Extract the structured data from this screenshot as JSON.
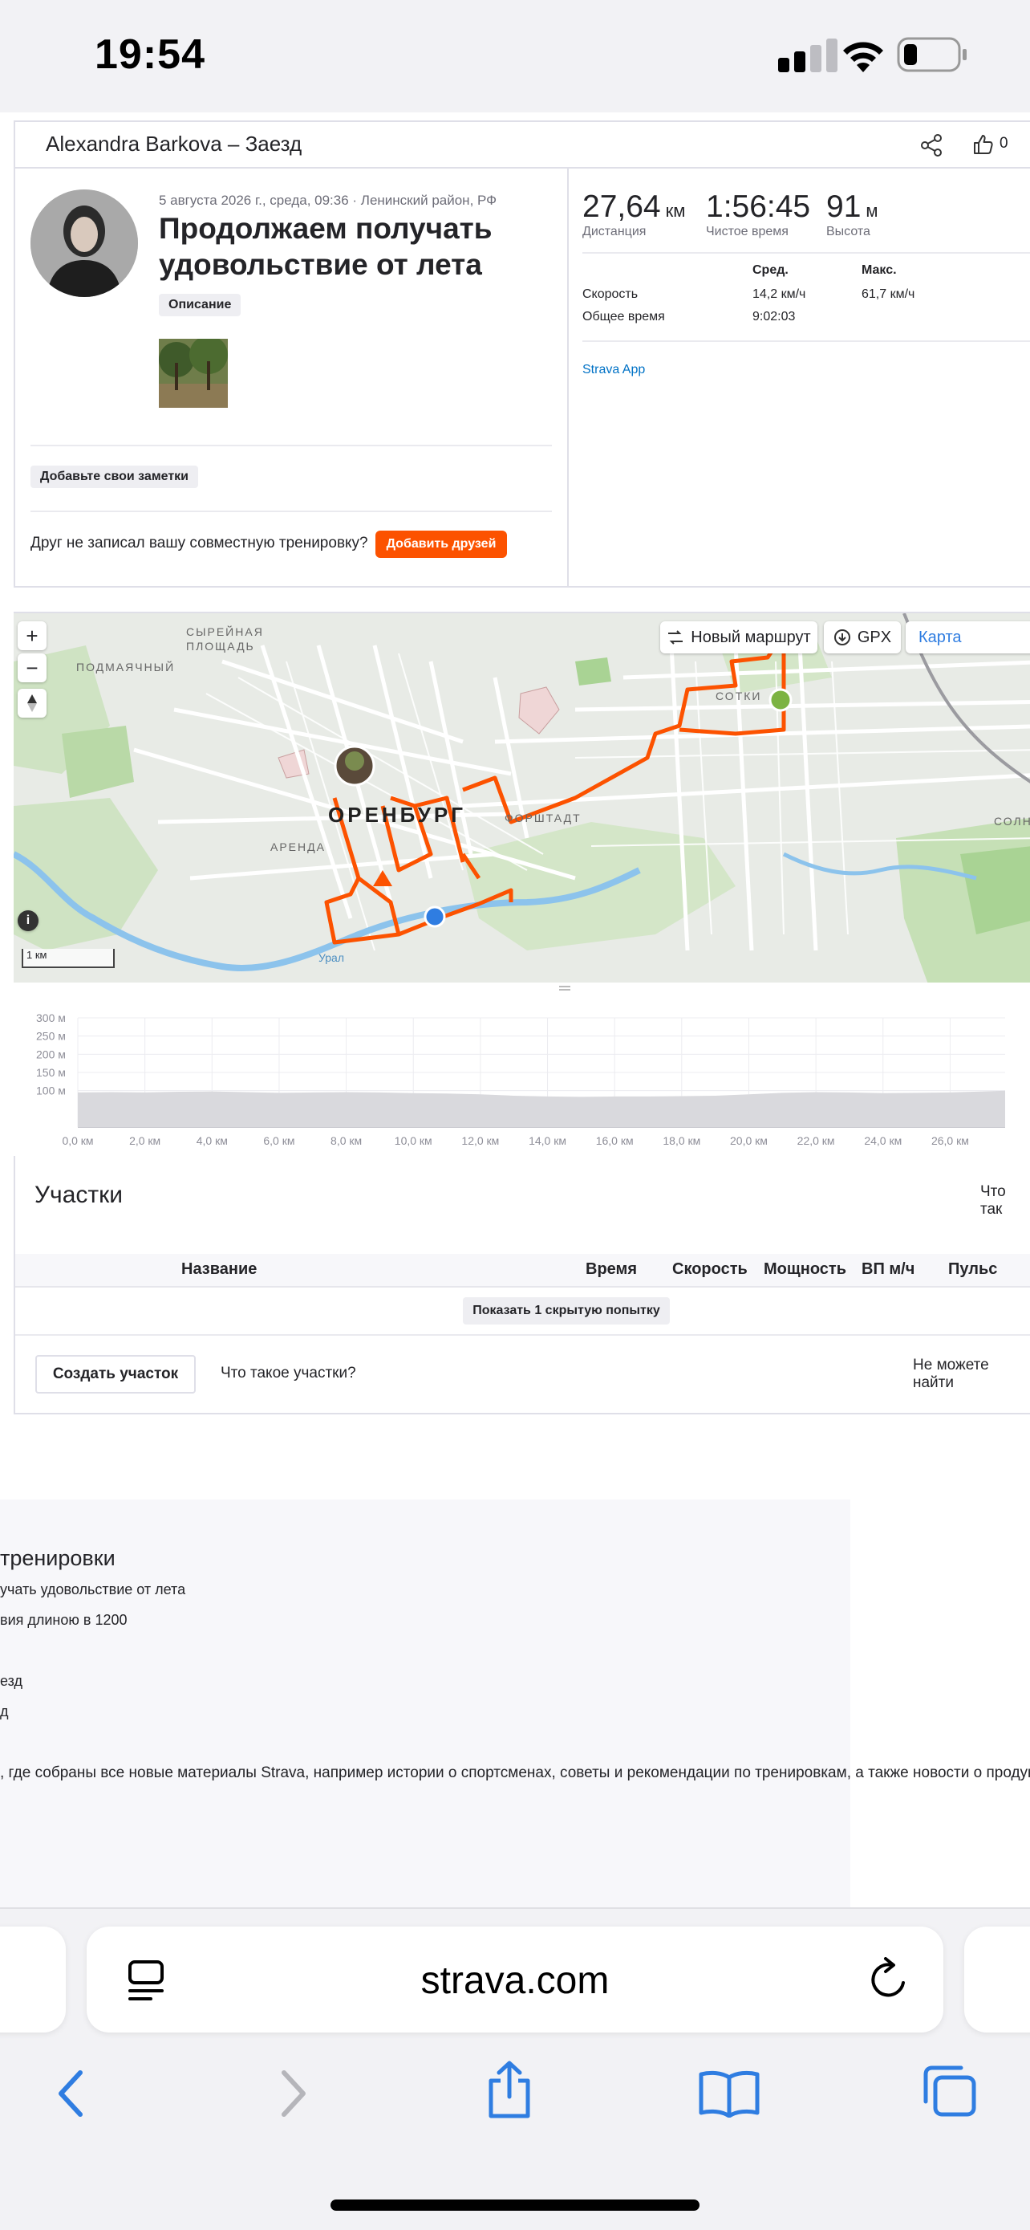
{
  "status": {
    "time": "19:54"
  },
  "activity": {
    "header_title": "Alexandra Barkova – Заезд",
    "kudos_count": "0",
    "meta": "5 августа 2026 г., среда, 09:36 · Ленинский район, РФ",
    "title": "Продолжаем получать удовольствие от лета",
    "description_chip": "Описание",
    "notes_chip": "Добавьте свои заметки",
    "friend_prompt": "Друг не записал вашу совместную тренировку?",
    "add_friends": "Добавить друзей",
    "stats": [
      {
        "value": "27,64",
        "unit": "км",
        "label": "Дистанция"
      },
      {
        "value": "1:56:45",
        "unit": "",
        "label": "Чистое время"
      },
      {
        "value": "91",
        "unit": "м",
        "label": "Высота"
      }
    ],
    "table": {
      "col_avg": "Сред.",
      "col_max": "Макс.",
      "rows": [
        {
          "label": "Скорость",
          "avg": "14,2 км/ч",
          "max": "61,7 км/ч"
        },
        {
          "label": "Общее время",
          "avg": "9:02:03",
          "max": ""
        }
      ]
    },
    "device": "Strava App"
  },
  "map": {
    "new_route": "Новый маршрут",
    "gpx": "GPX",
    "map_type": "Карта",
    "scale": "1 км",
    "zoom_in": "+",
    "zoom_out": "−",
    "labels": {
      "city": "ОРЕНБУРГ",
      "l1": "СЫРЕЙНАЯ",
      "l1b": "ПЛОЩАДЬ",
      "l2": "ПОДМАЯЧНЫЙ",
      "l3": "АРЕНДА",
      "l4": "ФОРШТАДТ",
      "l5": "СОТКИ",
      "l6": "СОЛНЕ",
      "river": "Урал"
    },
    "route_color": "#fc5200"
  },
  "chart_data": {
    "type": "area",
    "x": [
      0,
      1,
      2,
      3,
      4,
      5,
      6,
      7,
      8,
      9,
      10,
      11,
      12,
      13,
      14,
      15,
      16,
      17,
      18,
      19,
      20,
      21,
      22,
      23,
      24,
      25,
      26,
      27,
      27.64
    ],
    "y": [
      95,
      96,
      95,
      97,
      98,
      96,
      94,
      95,
      96,
      95,
      93,
      92,
      90,
      86,
      84,
      83,
      84,
      84,
      85,
      86,
      90,
      94,
      96,
      95,
      93,
      94,
      95,
      98,
      100
    ],
    "xlim": [
      0,
      27.64
    ],
    "ylim": [
      0,
      300
    ],
    "x_ticks": [
      "0,0 км",
      "2,0 км",
      "4,0 км",
      "6,0 км",
      "8,0 км",
      "10,0 км",
      "12,0 км",
      "14,0 км",
      "16,0 км",
      "18,0 км",
      "20,0 км",
      "22,0 км",
      "24,0 км",
      "26,0 км"
    ],
    "x_tick_values": [
      0,
      2,
      4,
      6,
      8,
      10,
      12,
      14,
      16,
      18,
      20,
      22,
      24,
      26
    ],
    "y_ticks": [
      "100 м",
      "150 м",
      "200 м",
      "250 м",
      "300 м"
    ],
    "y_tick_values": [
      100,
      150,
      200,
      250,
      300
    ],
    "fill": "#d9d9dd"
  },
  "segments": {
    "title": "Участки",
    "right_link": "Что так",
    "columns": [
      "Название",
      "Время",
      "Скорость",
      "Мощность",
      "ВП м/ч",
      "Пульс"
    ],
    "show_hidden": "Показать 1 скрытую попытку",
    "create": "Создать участок",
    "what_are": "Что такое участки?",
    "cant_find": "Не можете найти"
  },
  "footer": {
    "heading": "тренировки",
    "line1": "учать удовольствие от лета",
    "line2": "вия длиною в 1200",
    "line3": "езд",
    "line4": "д",
    "line5": ", где собраны все новые материалы Strava, например истории о спортсменах, советы и рекомендации по тренировкам, а также новости о продукта"
  },
  "browser": {
    "url": "strava.com"
  }
}
